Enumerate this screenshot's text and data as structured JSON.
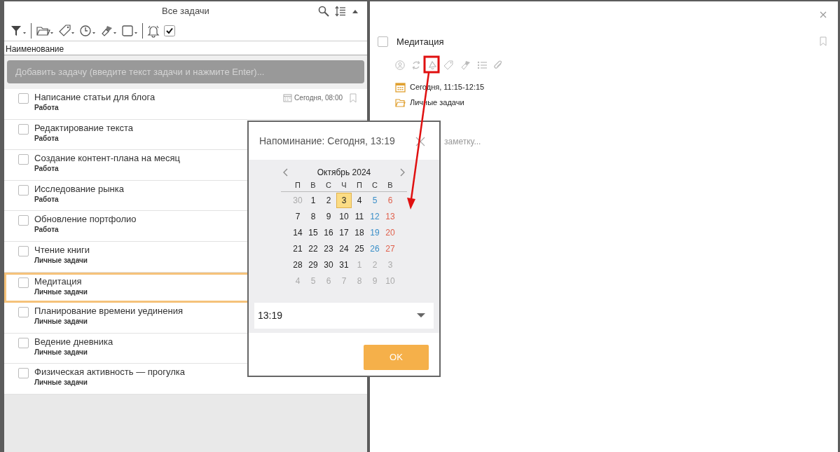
{
  "list_panel": {
    "title": "Все задачи",
    "show_completed": {
      "checked": true
    },
    "column_header": "Наименование",
    "add_task": {
      "placeholder": "Добавить задачу (введите текст задачи и нажмите Enter)..."
    },
    "tasks": [
      {
        "title": "Написание статьи для блога",
        "category": "Работа",
        "checked": false,
        "selected": false,
        "due": "Сегодня, 08:00"
      },
      {
        "title": "Редактирование текста",
        "category": "Работа",
        "checked": false,
        "selected": false
      },
      {
        "title": "Создание контент-плана на месяц",
        "category": "Работа",
        "checked": false,
        "selected": false
      },
      {
        "title": "Исследование рынка",
        "category": "Работа",
        "checked": false,
        "selected": false
      },
      {
        "title": "Обновление портфолио",
        "category": "Работа",
        "checked": false,
        "selected": false
      },
      {
        "title": "Чтение книги",
        "category": "Личные задачи",
        "checked": false,
        "selected": false
      },
      {
        "title": "Медитация",
        "category": "Личные задачи",
        "checked": false,
        "selected": true
      },
      {
        "title": "Планирование времени уединения",
        "category": "Личные задачи",
        "checked": false,
        "selected": false
      },
      {
        "title": "Ведение дневника",
        "category": "Личные задачи",
        "checked": false,
        "selected": false
      },
      {
        "title": "Физическая активность — прогулка",
        "category": "Личные задачи",
        "checked": false,
        "selected": false
      }
    ]
  },
  "detail": {
    "title": "Медитация",
    "checked": false,
    "date": "Сегодня, 11:15-12:15",
    "folder": "Личные задачи",
    "note": {
      "placeholder": "заметку..."
    }
  },
  "reminder_dialog": {
    "title": "Напоминание: Сегодня, 13:19",
    "month": "Октябрь 2024",
    "weekdays": [
      "П",
      "В",
      "С",
      "Ч",
      "П",
      "С",
      "В"
    ],
    "weeks": [
      [
        {
          "day": "30",
          "kind": "other",
          "selected": false
        },
        {
          "day": "1",
          "kind": "weekday",
          "selected": false
        },
        {
          "day": "2",
          "kind": "weekday",
          "selected": false
        },
        {
          "day": "3",
          "kind": "weekday",
          "selected": true
        },
        {
          "day": "4",
          "kind": "weekday",
          "selected": false
        },
        {
          "day": "5",
          "kind": "saturday",
          "selected": false
        },
        {
          "day": "6",
          "kind": "sunday",
          "selected": false
        }
      ],
      [
        {
          "day": "7",
          "kind": "weekday",
          "selected": false
        },
        {
          "day": "8",
          "kind": "weekday",
          "selected": false
        },
        {
          "day": "9",
          "kind": "weekday",
          "selected": false
        },
        {
          "day": "10",
          "kind": "weekday",
          "selected": false
        },
        {
          "day": "11",
          "kind": "weekday",
          "selected": false
        },
        {
          "day": "12",
          "kind": "saturday",
          "selected": false
        },
        {
          "day": "13",
          "kind": "sunday",
          "selected": false
        }
      ],
      [
        {
          "day": "14",
          "kind": "weekday",
          "selected": false
        },
        {
          "day": "15",
          "kind": "weekday",
          "selected": false
        },
        {
          "day": "16",
          "kind": "weekday",
          "selected": false
        },
        {
          "day": "17",
          "kind": "weekday",
          "selected": false
        },
        {
          "day": "18",
          "kind": "weekday",
          "selected": false
        },
        {
          "day": "19",
          "kind": "saturday",
          "selected": false
        },
        {
          "day": "20",
          "kind": "sunday",
          "selected": false
        }
      ],
      [
        {
          "day": "21",
          "kind": "weekday",
          "selected": false
        },
        {
          "day": "22",
          "kind": "weekday",
          "selected": false
        },
        {
          "day": "23",
          "kind": "weekday",
          "selected": false
        },
        {
          "day": "24",
          "kind": "weekday",
          "selected": false
        },
        {
          "day": "25",
          "kind": "weekday",
          "selected": false
        },
        {
          "day": "26",
          "kind": "saturday",
          "selected": false
        },
        {
          "day": "27",
          "kind": "sunday",
          "selected": false
        }
      ],
      [
        {
          "day": "28",
          "kind": "weekday",
          "selected": false
        },
        {
          "day": "29",
          "kind": "weekday",
          "selected": false
        },
        {
          "day": "30",
          "kind": "weekday",
          "selected": false
        },
        {
          "day": "31",
          "kind": "weekday",
          "selected": false
        },
        {
          "day": "1",
          "kind": "other",
          "selected": false
        },
        {
          "day": "2",
          "kind": "other",
          "selected": false
        },
        {
          "day": "3",
          "kind": "other",
          "selected": false
        }
      ],
      [
        {
          "day": "4",
          "kind": "other",
          "selected": false
        },
        {
          "day": "5",
          "kind": "other",
          "selected": false
        },
        {
          "day": "6",
          "kind": "other",
          "selected": false
        },
        {
          "day": "7",
          "kind": "other",
          "selected": false
        },
        {
          "day": "8",
          "kind": "other",
          "selected": false
        },
        {
          "day": "9",
          "kind": "other",
          "selected": false
        },
        {
          "day": "10",
          "kind": "other",
          "selected": false
        }
      ]
    ],
    "time": "13:19",
    "ok": "OK"
  }
}
